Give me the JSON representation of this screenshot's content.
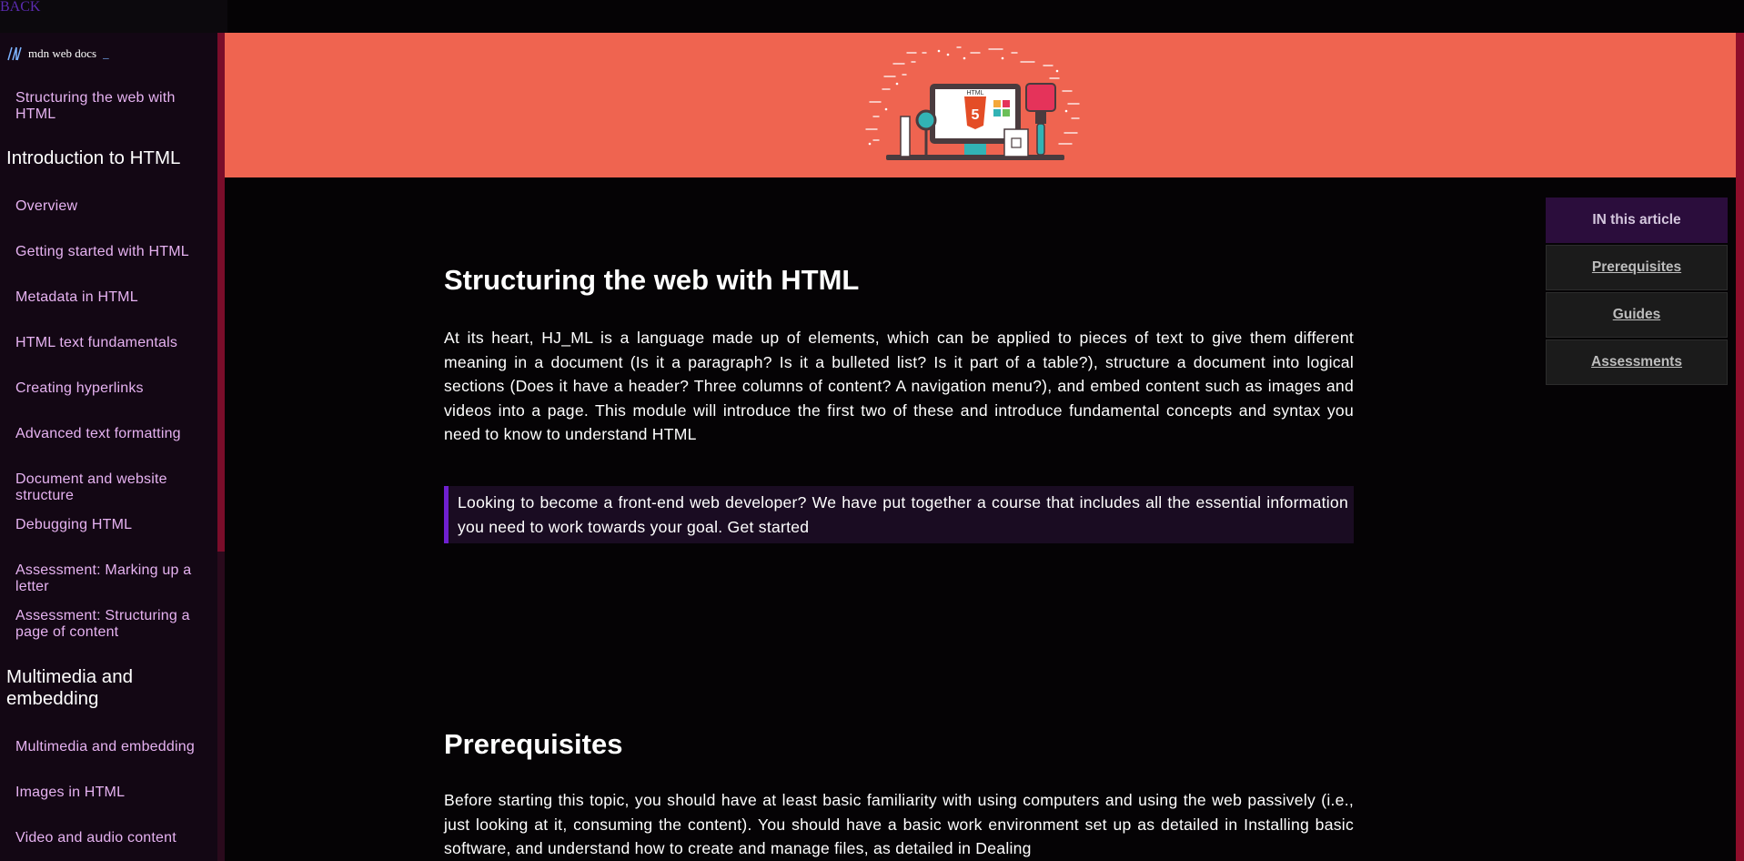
{
  "topbar": {
    "back_label": "BACK"
  },
  "sidebar": {
    "logo_text": "mdn web docs",
    "logo_cursor": "_",
    "module_link": "Structuring the web with HTML",
    "sections": [
      {
        "heading": "Introduction to HTML",
        "items": [
          "Overview",
          "Getting started with HTML",
          "Metadata in HTML",
          "HTML text fundamentals",
          "Creating hyperlinks",
          "Advanced text formatting",
          "Document and website structure",
          "Debugging HTML",
          "Assessment: Marking up a letter",
          "Assessment: Structuring a page of content"
        ]
      },
      {
        "heading": "Multimedia and embedding",
        "items": [
          "Multimedia and embedding",
          "Images in HTML",
          "Video and audio content"
        ]
      }
    ]
  },
  "banner": {
    "illustration": "html5-workstation-illustration",
    "badge_text": "HTML"
  },
  "article": {
    "title": "Structuring the web with HTML",
    "intro": "At its heart, HJ_ML is a language made up of elements, which can be applied to pieces of text to give them different meaning in a document (Is it a paragraph? Is it a bulleted list? Is it part of a table?), structure a document into logical sections (Does it have a header? Three columns of content? A navigation menu?), and embed content such as images and videos into a page. This module will introduce the first two of these and introduce fundamental concepts and syntax you need to know to understand HTML",
    "callout": "Looking to become a front-end web developer? We have put together a course that includes all the essential information you need to work towards your goal. Get started",
    "prerequisites_title": "Prerequisites",
    "prerequisites_text": "Before starting this topic, you should have at least basic familiarity with using computers and using the web passively (i.e., just looking at it, consuming the content). You should have a basic work environment set up as detailed in Installing basic software, and understand how to create and manage files, as detailed in Dealing"
  },
  "toc": {
    "header": "IN this article",
    "items": [
      "Prerequisites",
      "Guides",
      "Assessments"
    ]
  },
  "colors": {
    "banner": "#ef6450",
    "sidebar_bg": "#130714",
    "nav_link": "#e6b2f1",
    "accent_purple": "#6f20d0",
    "edge_red": "#8e0d2a"
  }
}
